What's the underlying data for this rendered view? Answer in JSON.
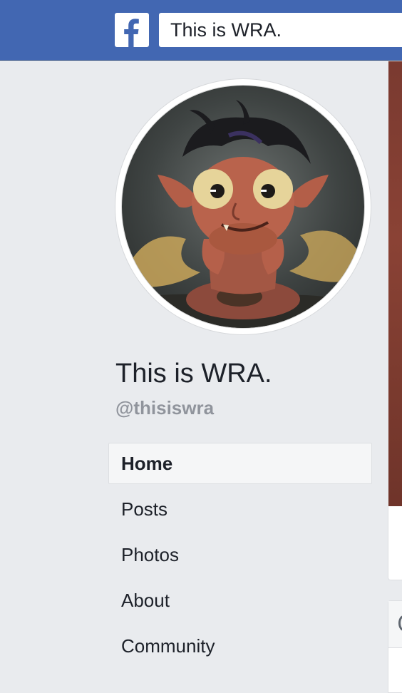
{
  "header": {
    "logo_icon": "facebook-f-icon",
    "search_value": "This is WRA.",
    "colors": {
      "bar": "#4267b2",
      "logo_bg": "#ffffff"
    }
  },
  "profile": {
    "avatar_alt": "goblin character avatar",
    "name": "This is WRA.",
    "handle": "@thisiswra"
  },
  "nav": {
    "items": [
      {
        "label": "Home",
        "active": true
      },
      {
        "label": "Posts",
        "active": false
      },
      {
        "label": "Photos",
        "active": false
      },
      {
        "label": "About",
        "active": false
      },
      {
        "label": "Community",
        "active": false
      }
    ]
  }
}
